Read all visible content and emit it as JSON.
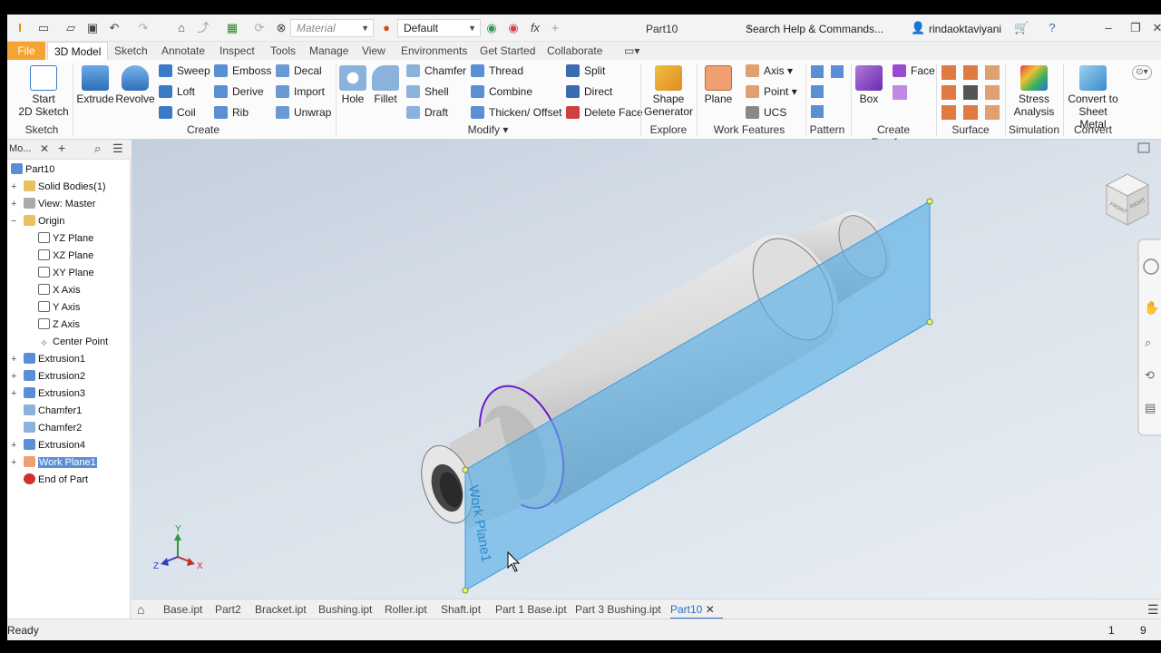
{
  "quick_access": {
    "material": "Material",
    "appearance": "Default",
    "doc_title": "Part10",
    "search": "Search Help & Commands...",
    "user": "rindaoktaviyani"
  },
  "tabs": {
    "file": "File",
    "items": [
      "3D Model",
      "Sketch",
      "Annotate",
      "Inspect",
      "Tools",
      "Manage",
      "View",
      "Environments",
      "Get Started",
      "Collaborate"
    ]
  },
  "ribbon": {
    "sketch": {
      "start": "Start",
      "start2": "2D Sketch",
      "label": "Sketch"
    },
    "create": {
      "extrude": "Extrude",
      "revolve": "Revolve",
      "sweep": "Sweep",
      "loft": "Loft",
      "coil": "Coil",
      "emboss": "Emboss",
      "derive": "Derive",
      "rib": "Rib",
      "decal": "Decal",
      "import": "Import",
      "unwrap": "Unwrap",
      "label": "Create"
    },
    "modify": {
      "hole": "Hole",
      "fillet": "Fillet",
      "chamfer": "Chamfer",
      "shell": "Shell",
      "draft": "Draft",
      "thread": "Thread",
      "combine": "Combine",
      "thicken": "Thicken/ Offset",
      "split": "Split",
      "direct": "Direct",
      "delete_face": "Delete Face",
      "label": "Modify"
    },
    "explore": {
      "shape1": "Shape",
      "shape2": "Generator",
      "label": "Explore"
    },
    "work_features": {
      "plane": "Plane",
      "axis": "Axis",
      "point": "Point",
      "ucs": "UCS",
      "label": "Work Features"
    },
    "pattern": {
      "label": "Pattern"
    },
    "freeform": {
      "box": "Box",
      "face": "Face",
      "label": "Create Freeform"
    },
    "surface": {
      "label": "Surface"
    },
    "simulation": {
      "stress1": "Stress",
      "stress2": "Analysis",
      "label": "Simulation"
    },
    "convert": {
      "c1": "Convert to",
      "c2": "Sheet Metal",
      "label": "Convert"
    }
  },
  "browser": {
    "title": "Mo...",
    "items": [
      {
        "label": "Part10"
      },
      {
        "label": "Solid Bodies(1)"
      },
      {
        "label": "View: Master"
      },
      {
        "label": "Origin"
      },
      {
        "label": "YZ Plane"
      },
      {
        "label": "XZ Plane"
      },
      {
        "label": "XY Plane"
      },
      {
        "label": "X Axis"
      },
      {
        "label": "Y Axis"
      },
      {
        "label": "Z Axis"
      },
      {
        "label": "Center Point"
      },
      {
        "label": "Extrusion1"
      },
      {
        "label": "Extrusion2"
      },
      {
        "label": "Extrusion3"
      },
      {
        "label": "Chamfer1"
      },
      {
        "label": "Chamfer2"
      },
      {
        "label": "Extrusion4"
      },
      {
        "label": "Work Plane1"
      },
      {
        "label": "End of Part"
      }
    ]
  },
  "viewport": {
    "workplane_label": "Work Plane1",
    "triad": {
      "x": "X",
      "y": "Y",
      "z": "Z"
    },
    "viewcube": {
      "front": "FRONT",
      "right": "RIGHT"
    }
  },
  "doc_tabs": [
    "Base.ipt",
    "Part2",
    "Bracket.ipt",
    "Bushing.ipt",
    "Roller.ipt",
    "Shaft.ipt",
    "Part 1 Base.ipt",
    "Part 3 Bushing.ipt",
    "Part10"
  ],
  "status": {
    "text": "Ready",
    "n1": "1",
    "n2": "9"
  },
  "colors": {
    "file_tab": "#f4a433",
    "workplane": "#5ab0e8",
    "selection": "#6a1bd1"
  }
}
